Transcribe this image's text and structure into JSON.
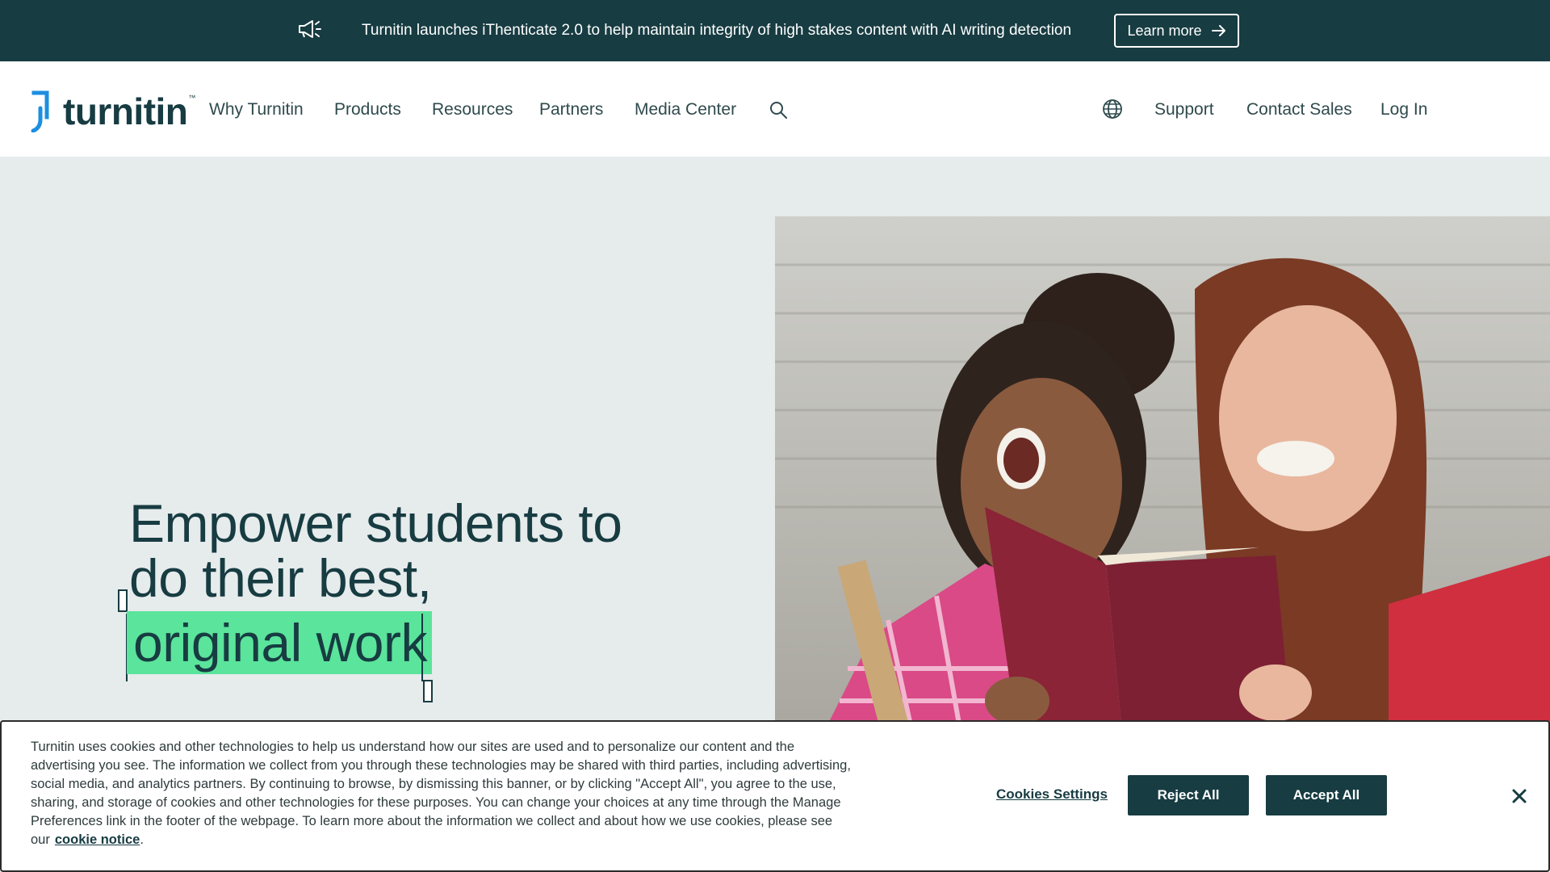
{
  "announcement": {
    "icon": "megaphone-icon",
    "message": "Turnitin launches iThenticate 2.0 to help maintain integrity of high stakes content with AI writing detection",
    "cta_label": "Learn more",
    "cta_icon": "arrow-right-icon"
  },
  "header": {
    "logo_text": "turnitin",
    "logo_tm": "™",
    "nav": [
      {
        "label": "Why Turnitin"
      },
      {
        "label": "Products"
      },
      {
        "label": "Resources"
      },
      {
        "label": "Partners"
      },
      {
        "label": "Media Center"
      }
    ],
    "search_icon": "search-icon",
    "globe_icon": "globe-icon",
    "right_nav": [
      {
        "label": "Support"
      },
      {
        "label": "Contact Sales"
      },
      {
        "label": "Log In"
      }
    ]
  },
  "hero": {
    "title_line1": "Empower students to",
    "title_line2": "do their best,",
    "highlight": "original work"
  },
  "cookie_banner": {
    "text": "Turnitin uses cookies and other technologies to help us understand how our sites are used and to personalize our content and the advertising you see. The information we collect from you through these technologies may be shared with third parties, including advertising, social media, and analytics partners. By continuing to browse, by dismissing this banner, or by clicking \"Accept All\", you agree to the use, sharing, and storage of cookies and other technologies for these purposes. You can change your choices at any time through the Manage Preferences link in the footer of the webpage. To learn more about the information we collect and about how we use cookies, please see our",
    "link_label": "cookie notice",
    "period": ".",
    "settings_label": "Cookies Settings",
    "reject_label": "Reject All",
    "accept_label": "Accept All",
    "close_icon": "close-icon"
  },
  "colors": {
    "brand_dark": "#173c42",
    "highlight_green": "#5be49b",
    "hero_bg": "#e6ebeb",
    "logo_blue": "#1d8fe0"
  }
}
